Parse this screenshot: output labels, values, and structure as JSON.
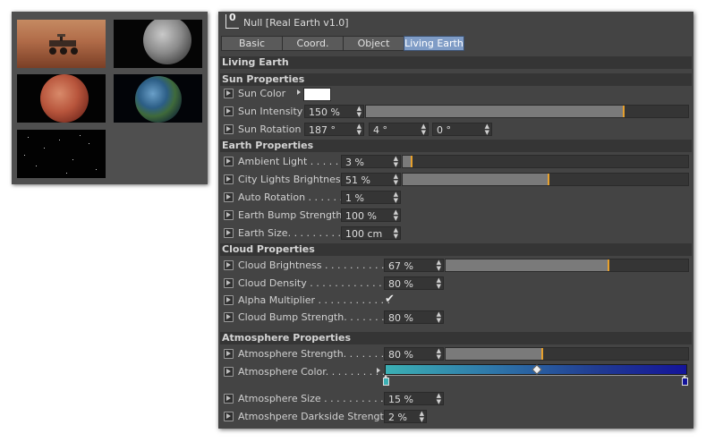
{
  "thumbnails": [
    {
      "name": "rover-on-mars"
    },
    {
      "name": "moon"
    },
    {
      "name": "mars-planet"
    },
    {
      "name": "earth-planet"
    },
    {
      "name": "starfield"
    }
  ],
  "object": {
    "title": "Null [Real Earth v1.0]",
    "icon": "null-object-icon",
    "icon_glyph": "0"
  },
  "tabs": [
    {
      "label": "Basic",
      "active": false
    },
    {
      "label": "Coord.",
      "active": false
    },
    {
      "label": "Object",
      "active": false
    },
    {
      "label": "Living Earth",
      "active": true
    }
  ],
  "panel_title": "Living Earth",
  "accent_color": "#e7a02c",
  "tab_active_color": "#7f9cc6",
  "sections": {
    "sun": "Sun Properties",
    "earth": "Earth Properties",
    "cloud": "Cloud Properties",
    "atmosphere": "Atmosphere Properties"
  },
  "sun": {
    "color_label": "Sun Color",
    "color_value": "#ffffff",
    "intensity_label": "Sun Intensity",
    "intensity_value": "150 %",
    "intensity_level": 0.8,
    "rotation_label": "Sun Rotation",
    "rotation_h": "187 °",
    "rotation_p": "4 °",
    "rotation_b": "0 °"
  },
  "earth": {
    "ambient_label": "Ambient Light . . . . . .",
    "ambient_value": "3 %",
    "ambient_level": 0.03,
    "city_label": "City Lights Brightness",
    "city_value": "51 %",
    "city_level": 0.51,
    "autorot_label": "Auto Rotation . . . . . .",
    "autorot_value": "1 %",
    "bump_label": "Earth Bump Strength",
    "bump_value": "100 %",
    "size_label": "Earth Size. . . . . . . . . .",
    "size_value": "100 cm"
  },
  "cloud": {
    "brightness_label": "Cloud Brightness . . . . . . . . . . .",
    "brightness_value": "67 %",
    "brightness_level": 0.67,
    "density_label": "Cloud Density . . . . . . . . . . . . .",
    "density_value": "80 %",
    "alpha_label": "Alpha Multiplier . . . . . . . . . . . .",
    "alpha_checked": "✔",
    "bump_label": "Cloud Bump Strength. . . . . . . .",
    "bump_value": "80 %"
  },
  "atmosphere": {
    "strength_label": "Atmosphere Strength. . . . . . . . .",
    "strength_value": "80 %",
    "strength_level": 0.4,
    "color_label": "Atmosphere Color. . . . . . . . . .",
    "gradient_start": "#3bb0b4",
    "gradient_end": "#14149a",
    "size_label": "Atmosphere Size . . . . . . . . . . . .",
    "size_value": "15 %",
    "darkside_label": "Atmoshpere Darkside Strength",
    "darkside_value": "2 %"
  }
}
